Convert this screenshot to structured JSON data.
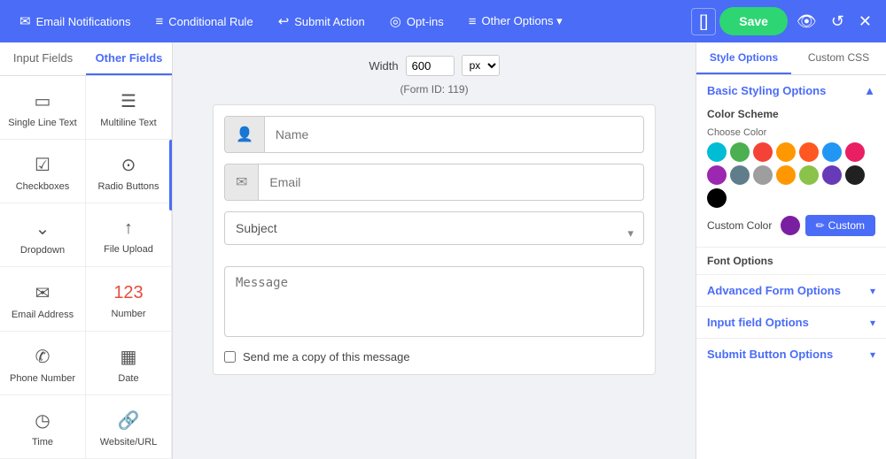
{
  "topNav": {
    "items": [
      {
        "id": "email-notifications",
        "icon": "✉",
        "label": "Email Notifications"
      },
      {
        "id": "conditional-rule",
        "icon": "≡",
        "label": "Conditional Rule"
      },
      {
        "id": "submit-action",
        "icon": "↩",
        "label": "Submit Action"
      },
      {
        "id": "opt-ins",
        "icon": "◎",
        "label": "Opt-ins"
      },
      {
        "id": "other-options",
        "icon": "≡",
        "label": "Other Options ▾"
      }
    ],
    "saveLabel": "Save",
    "bracketIcon": "[]"
  },
  "leftPanel": {
    "tabs": [
      {
        "id": "input-fields",
        "label": "Input Fields"
      },
      {
        "id": "other-fields",
        "label": "Other Fields"
      }
    ],
    "activeTab": "other-fields",
    "fields": [
      {
        "id": "single-line-text",
        "icon": "▭",
        "label": "Single Line Text"
      },
      {
        "id": "multiline-text",
        "icon": "☰",
        "label": "Multiline Text"
      },
      {
        "id": "checkboxes",
        "icon": "☑",
        "label": "Checkboxes"
      },
      {
        "id": "radio-buttons",
        "icon": "⊙",
        "label": "Radio Buttons"
      },
      {
        "id": "dropdown",
        "icon": "⌄",
        "label": "Dropdown"
      },
      {
        "id": "file-upload",
        "icon": "↑",
        "label": "File Upload"
      },
      {
        "id": "email-address",
        "icon": "✉",
        "label": "Email Address"
      },
      {
        "id": "number",
        "icon": "123",
        "label": "Number",
        "highlight": true
      },
      {
        "id": "phone-number",
        "icon": "✆",
        "label": "Phone Number"
      },
      {
        "id": "date",
        "icon": "▦",
        "label": "Date"
      },
      {
        "id": "time",
        "icon": "◷",
        "label": "Time"
      },
      {
        "id": "website-url",
        "icon": "🔗",
        "label": "Website/URL"
      }
    ]
  },
  "centerPanel": {
    "widthLabel": "Width",
    "widthValue": "600",
    "widthUnit": "px",
    "formId": "(Form ID: 119)",
    "fields": [
      {
        "id": "name",
        "placeholder": "Name",
        "icon": "👤"
      },
      {
        "id": "email",
        "placeholder": "Email",
        "icon": "✉"
      }
    ],
    "subjectPlaceholder": "Subject",
    "messagePlaceholder": "Message",
    "checkboxLabel": "Send me a copy of this message"
  },
  "rightPanel": {
    "tabs": [
      {
        "id": "style-options",
        "label": "Style Options"
      },
      {
        "id": "custom-css",
        "label": "Custom CSS"
      }
    ],
    "activeTab": "style-options",
    "basicStyling": {
      "title": "Basic Styling Options",
      "colorScheme": {
        "label": "Color Scheme",
        "chooseColorLabel": "Choose Color",
        "colors": [
          "#00bcd4",
          "#4caf50",
          "#f44336",
          "#ff9800",
          "#ff5722",
          "#2196f3",
          "#e91e63",
          "#9c27b0",
          "#607d8b",
          "#9e9e9e",
          "#ff9800",
          "#8bc34a",
          "#673ab7",
          "#212121",
          "#000000"
        ],
        "customColorLabel": "Custom Color",
        "customColorValue": "#7b1fa2",
        "customBtnLabel": "Custom",
        "customBtnIcon": "✏"
      },
      "fontOptionsLabel": "Font Options"
    },
    "advancedOptions": {
      "title": "Advanced Form Options"
    },
    "inputFieldOptions": {
      "title": "Input field Options"
    },
    "submitButtonOptions": {
      "title": "Submit Button Options"
    }
  }
}
